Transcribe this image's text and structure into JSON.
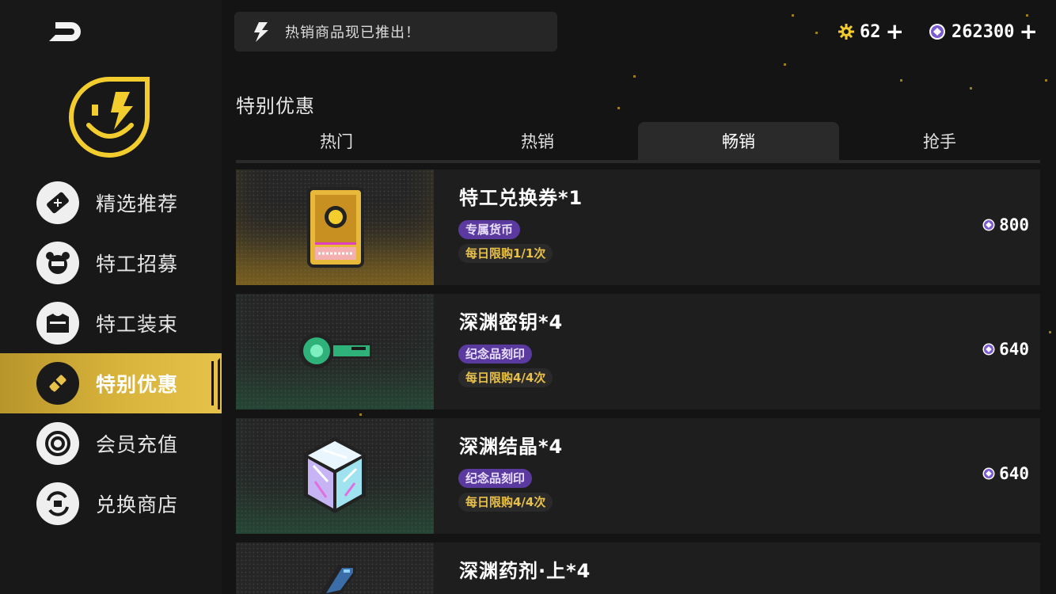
{
  "banner": {
    "text": "热销商品现已推出！"
  },
  "currency": {
    "gold": {
      "value": "62",
      "plus": "+"
    },
    "gems": {
      "value": "262300",
      "plus": "+"
    }
  },
  "sidebar": {
    "items": [
      {
        "label": "精选推荐",
        "icon": "ticket-icon"
      },
      {
        "label": "特工招募",
        "icon": "agent-bear-icon"
      },
      {
        "label": "特工装束",
        "icon": "costume-icon"
      },
      {
        "label": "特别优惠",
        "icon": "special-offer-icon",
        "active": true
      },
      {
        "label": "会员充值",
        "icon": "target-coin-icon"
      },
      {
        "label": "兑换商店",
        "icon": "exchange-icon"
      }
    ]
  },
  "section": {
    "title": "特别优惠"
  },
  "tabs": [
    {
      "label": "热门"
    },
    {
      "label": "热销"
    },
    {
      "label": "畅销",
      "active": true
    },
    {
      "label": "抢手"
    }
  ],
  "products": [
    {
      "name": "特工兑换券*1",
      "tag": "专属货币",
      "limit": "每日限购1/1次",
      "price": "800",
      "icon": "agent-voucher-icon"
    },
    {
      "name": "深渊密钥*4",
      "tag": "纪念品刻印",
      "limit": "每日限购4/4次",
      "price": "640",
      "icon": "abyss-key-icon"
    },
    {
      "name": "深渊结晶*4",
      "tag": "纪念品刻印",
      "limit": "每日限购4/4次",
      "price": "640",
      "icon": "abyss-crystal-icon"
    },
    {
      "name": "深渊药剂·上*4",
      "icon": "abyss-potion-icon"
    }
  ],
  "colors": {
    "accent_gold": "#d9b43c",
    "tag_purple": "#5b3aa0",
    "limit_text": "#e8c04a"
  }
}
